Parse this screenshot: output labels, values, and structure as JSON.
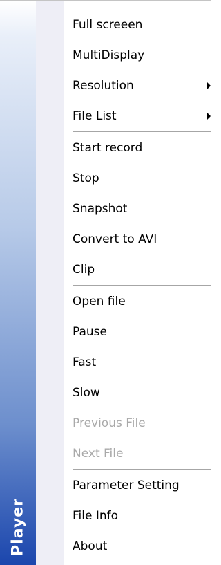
{
  "banner": {
    "label": "Player"
  },
  "groups": [
    [
      {
        "name": "menu-item-full-screen",
        "label": "Full screeen",
        "enabled": true,
        "submenu": false
      },
      {
        "name": "menu-item-multidisplay",
        "label": "MultiDisplay",
        "enabled": true,
        "submenu": false
      },
      {
        "name": "menu-item-resolution",
        "label": "Resolution",
        "enabled": true,
        "submenu": true
      },
      {
        "name": "menu-item-file-list",
        "label": "File List",
        "enabled": true,
        "submenu": true
      }
    ],
    [
      {
        "name": "menu-item-start-record",
        "label": "Start record",
        "enabled": true,
        "submenu": false
      },
      {
        "name": "menu-item-stop",
        "label": "Stop",
        "enabled": true,
        "submenu": false
      },
      {
        "name": "menu-item-snapshot",
        "label": "Snapshot",
        "enabled": true,
        "submenu": false
      },
      {
        "name": "menu-item-convert-to-avi",
        "label": "Convert to AVI",
        "enabled": true,
        "submenu": false
      },
      {
        "name": "menu-item-clip",
        "label": "Clip",
        "enabled": true,
        "submenu": false
      }
    ],
    [
      {
        "name": "menu-item-open-file",
        "label": "Open file",
        "enabled": true,
        "submenu": false
      },
      {
        "name": "menu-item-pause",
        "label": "Pause",
        "enabled": true,
        "submenu": false
      },
      {
        "name": "menu-item-fast",
        "label": "Fast",
        "enabled": true,
        "submenu": false
      },
      {
        "name": "menu-item-slow",
        "label": "Slow",
        "enabled": true,
        "submenu": false
      },
      {
        "name": "menu-item-previous-file",
        "label": "Previous File",
        "enabled": false,
        "submenu": false
      },
      {
        "name": "menu-item-next-file",
        "label": "Next File",
        "enabled": false,
        "submenu": false
      }
    ],
    [
      {
        "name": "menu-item-parameter-setting",
        "label": "Parameter Setting",
        "enabled": true,
        "submenu": false
      },
      {
        "name": "menu-item-file-info",
        "label": "File Info",
        "enabled": true,
        "submenu": false
      },
      {
        "name": "menu-item-about",
        "label": "About",
        "enabled": true,
        "submenu": false
      }
    ]
  ],
  "colors": {
    "banner_top": "#ffffff",
    "banner_bottom": "#1b46ad",
    "disabled_text": "#a9a9a9",
    "icon_column": "#eeeef6"
  },
  "icons": {
    "submenu": "arrow-right-icon"
  }
}
